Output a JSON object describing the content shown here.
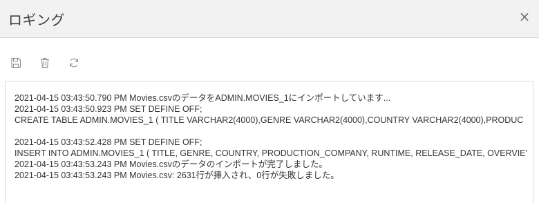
{
  "dialog": {
    "title": "ロギング",
    "close_label": "×"
  },
  "toolbar": {
    "buttons": [
      {
        "icon": "save-icon"
      },
      {
        "icon": "trash-icon"
      },
      {
        "icon": "refresh-icon"
      }
    ]
  },
  "log": {
    "lines": [
      "2021-04-15 03:43:50.790 PM Movies.csvのデータをADMIN.MOVIES_1にインポートしています...",
      "2021-04-15 03:43:50.923 PM SET DEFINE OFF;",
      "CREATE TABLE ADMIN.MOVIES_1 ( TITLE VARCHAR2(4000),GENRE VARCHAR2(4000),COUNTRY VARCHAR2(4000),PRODUC",
      "",
      "2021-04-15 03:43:52.428 PM SET DEFINE OFF;",
      "INSERT INTO ADMIN.MOVIES_1 ( TITLE, GENRE, COUNTRY, PRODUCTION_COMPANY, RUNTIME, RELEASE_DATE, OVERVIE'",
      "2021-04-15 03:43:53.243 PM Movies.csvのデータのインポートが完了しました。",
      "2021-04-15 03:43:53.243 PM Movies.csv: 2631行が挿入され、0行が失敗しました。"
    ]
  },
  "colors": {
    "header_bg": "#f2f2f2",
    "icon_gray": "#8a8a8a",
    "border": "#d9d9d9"
  }
}
